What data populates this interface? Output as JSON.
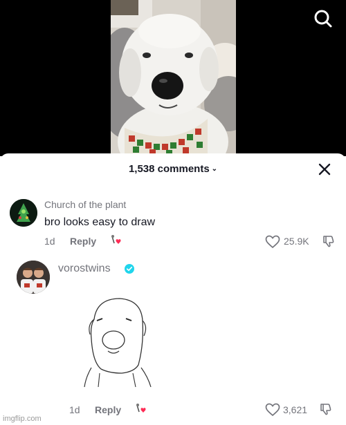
{
  "header": {
    "comment_count": "1,538 comments"
  },
  "comments": [
    {
      "username": "Church of the plant",
      "text": "bro looks easy to draw",
      "time": "1d",
      "reply_label": "Reply",
      "likes": "25.9K"
    },
    {
      "username": "vorostwins",
      "verified": true,
      "time": "1d",
      "reply_label": "Reply",
      "likes": "3,621"
    }
  ],
  "watermark": "imgflip.com",
  "colors": {
    "verified": "#20d5ec",
    "heart_sticker": "#fe2c55",
    "meta_gray": "#73747b"
  }
}
